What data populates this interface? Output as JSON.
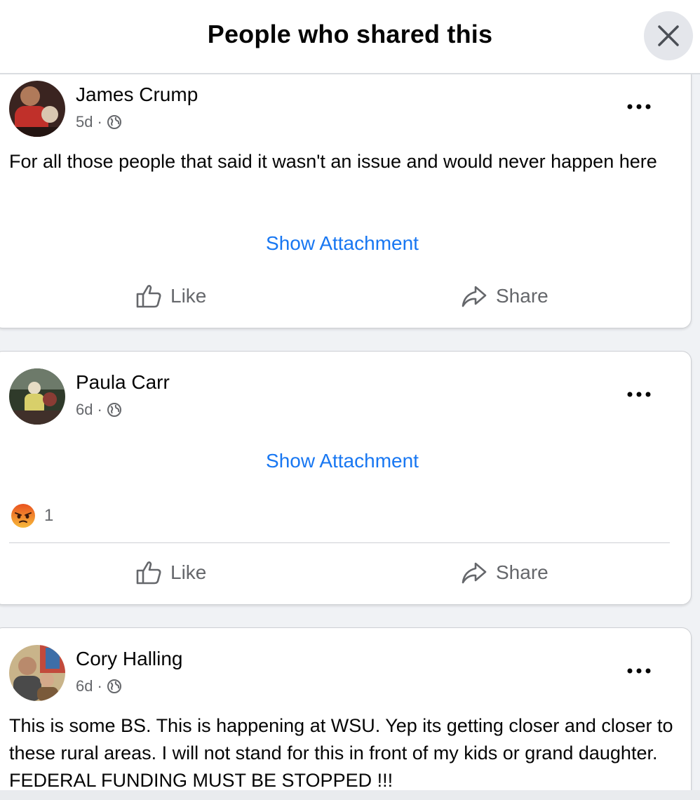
{
  "dialog": {
    "title": "People who shared this",
    "close_icon": "close-icon"
  },
  "posts": [
    {
      "author": "James Crump",
      "time": "5d",
      "separator": "·",
      "audience_icon": "globe-icon",
      "text": "For all those people that said it wasn't an issue and would never happen here",
      "attachment_label": "Show Attachment",
      "like_label": "Like",
      "share_label": "Share"
    },
    {
      "author": "Paula Carr",
      "time": "6d",
      "separator": "·",
      "audience_icon": "globe-icon",
      "attachment_label": "Show Attachment",
      "reaction_icon": "angry-reaction-icon",
      "reaction_count": "1",
      "like_label": "Like",
      "share_label": "Share"
    },
    {
      "author": "Cory Halling",
      "time": "6d",
      "separator": "·",
      "audience_icon": "globe-icon",
      "text": "This is some BS. This is happening at WSU. Yep its getting closer and closer to these rural areas. I will not stand for this in front of my kids or grand daughter. FEDERAL FUNDING MUST BE STOPPED !!!"
    }
  ],
  "colors": {
    "link": "#1877f2",
    "secondary_text": "#65676b",
    "page_bg": "#f0f2f5",
    "angry": "#f7714c"
  }
}
